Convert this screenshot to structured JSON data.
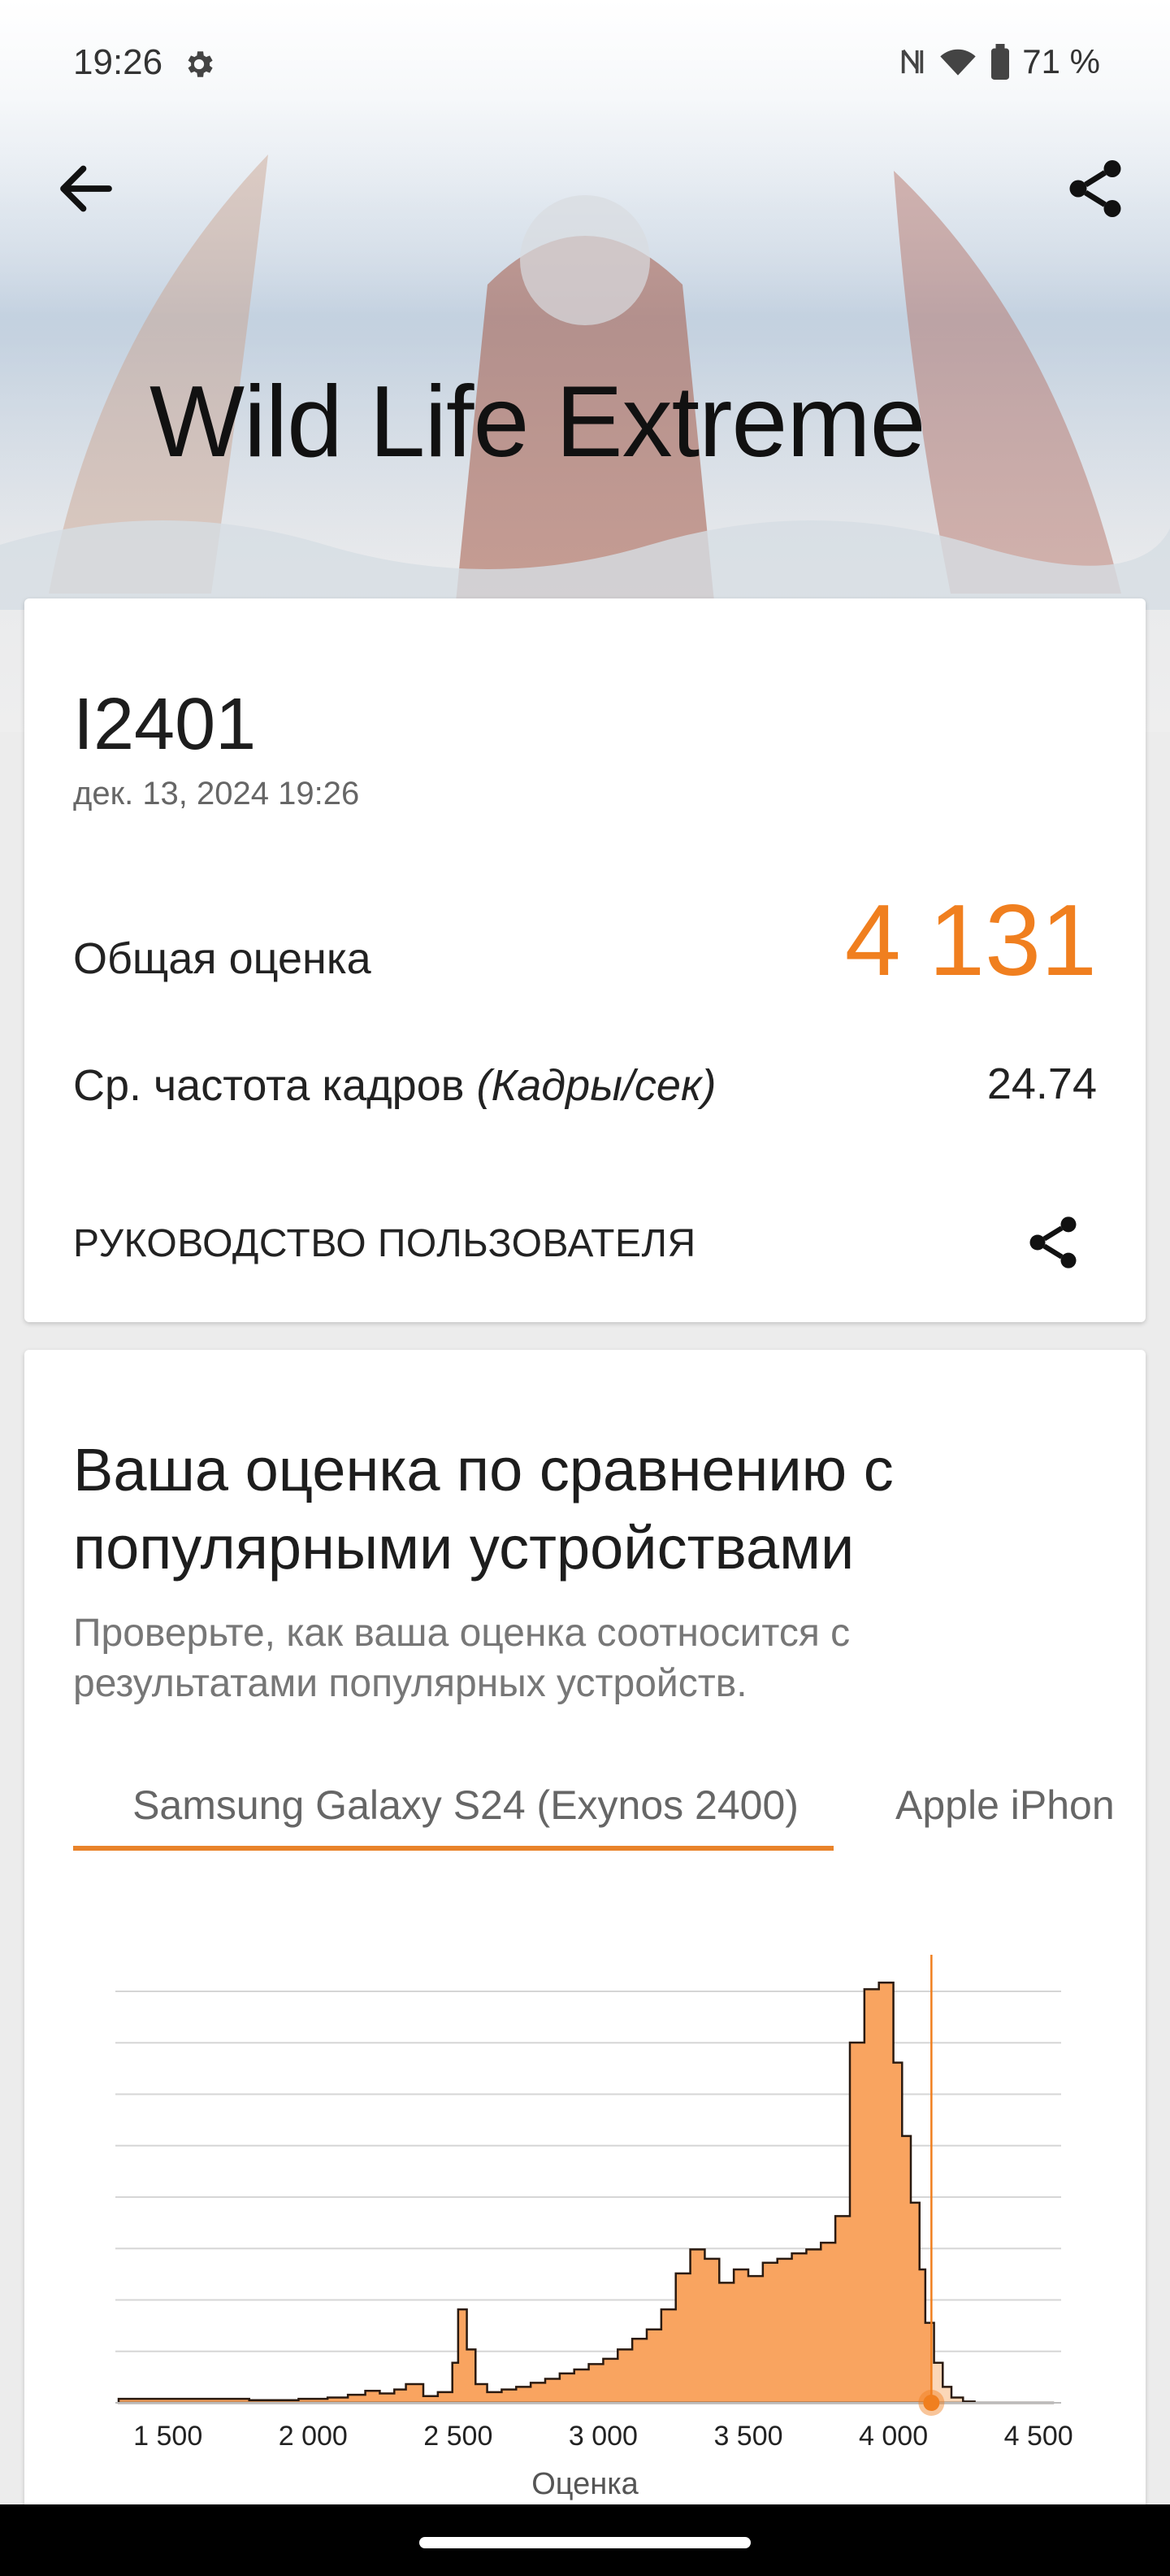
{
  "status_bar": {
    "time": "19:26",
    "battery": "71 %"
  },
  "hero": {
    "title": "Wild Life Extreme"
  },
  "result": {
    "device": "I2401",
    "date": "дек. 13, 2024 19:26",
    "overall_label": "Общая оценка",
    "overall_value": "4 131",
    "fps_label": "Ср. частота кадров",
    "fps_unit": "(Кадры/сек)",
    "fps_value": "24.74",
    "guide_label": "РУКОВОДСТВО ПОЛЬЗОВАТЕЛЯ"
  },
  "comparison": {
    "title": "Ваша оценка по сравнению с популярными устройствами",
    "subtitle": "Проверьте, как ваша оценка соотносится с результатами популярных устройств.",
    "tabs": [
      {
        "label": "Samsung Galaxy S24 (Exynos 2400)",
        "selected": true
      },
      {
        "label": "Apple iPhon",
        "selected": false
      }
    ]
  },
  "colors": {
    "accent": "#f07f1f",
    "histogram_fill": "#f9a460",
    "histogram_fill_light": "#fbd7b8",
    "histogram_stroke": "#2a1a10"
  },
  "chart_data": {
    "type": "area",
    "xlabel": "Оценка",
    "x_ticks": [
      "1 500",
      "2 000",
      "2 500",
      "3 000",
      "3 500",
      "4 000",
      "4 500"
    ],
    "xlim": [
      1330,
      4550
    ],
    "your_score": 4131,
    "x": [
      1330,
      1400,
      1500,
      1600,
      1700,
      1780,
      1850,
      1950,
      2000,
      2050,
      2120,
      2180,
      2230,
      2280,
      2320,
      2380,
      2430,
      2480,
      2500,
      2530,
      2560,
      2600,
      2650,
      2700,
      2750,
      2800,
      2850,
      2900,
      2950,
      3000,
      3050,
      3100,
      3150,
      3200,
      3250,
      3300,
      3350,
      3400,
      3450,
      3500,
      3550,
      3600,
      3650,
      3700,
      3750,
      3800,
      3850,
      3900,
      3950,
      4000,
      4030,
      4060,
      4090,
      4110,
      4140,
      4170,
      4200,
      4240,
      4280,
      4320,
      4360,
      4400,
      4440,
      4480,
      4520
    ],
    "values": [
      3,
      3,
      3,
      3,
      3,
      2,
      2,
      3,
      3,
      4,
      6,
      9,
      7,
      10,
      14,
      5,
      8,
      30,
      70,
      40,
      14,
      8,
      10,
      12,
      15,
      18,
      22,
      25,
      29,
      33,
      40,
      48,
      55,
      70,
      97,
      115,
      108,
      90,
      100,
      95,
      105,
      108,
      112,
      115,
      120,
      140,
      270,
      310,
      315,
      255,
      200,
      150,
      100,
      60,
      30,
      12,
      4,
      1,
      0,
      0,
      0,
      0,
      0,
      0,
      0
    ],
    "ylim": [
      0,
      320
    ]
  }
}
